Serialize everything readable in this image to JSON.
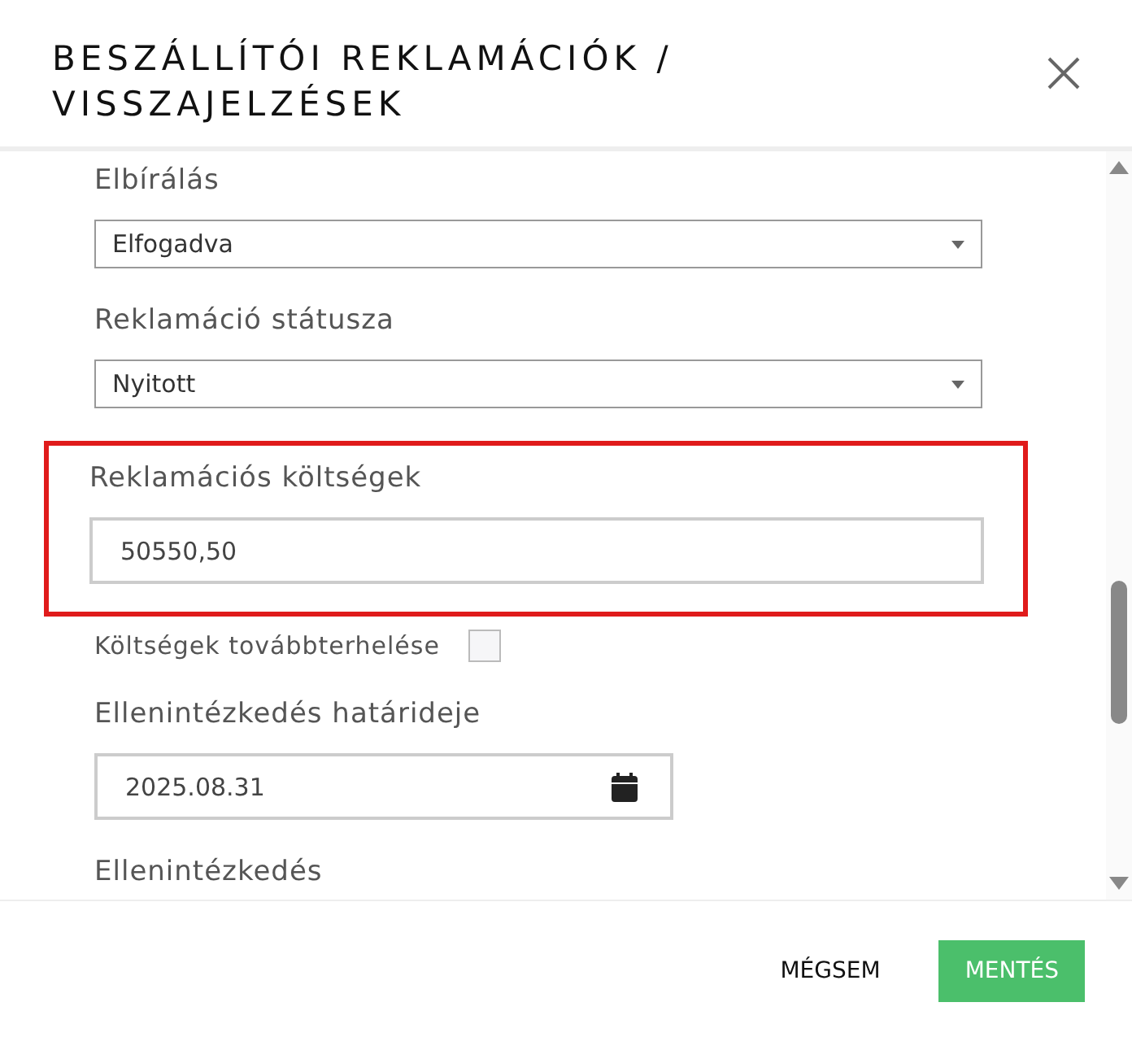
{
  "dialog": {
    "title": "BESZÁLLÍTÓI REKLAMÁCIÓK / VISSZAJELZÉSEK"
  },
  "fields": [
    {
      "kind": "select",
      "label": "Elbírálás",
      "value": "Elfogadva",
      "highlighted": false
    },
    {
      "kind": "select",
      "label": "Reklamáció státusza",
      "value": "Nyitott",
      "highlighted": false
    },
    {
      "kind": "text",
      "label": "Reklamációs költségek",
      "value": "50550,50",
      "highlighted": true
    },
    {
      "kind": "checkbox",
      "label": "Költségek továbbterhelése",
      "checked": false,
      "highlighted": false
    },
    {
      "kind": "date",
      "label": "Ellenintézkedés határideje",
      "value": "2025.08.31",
      "highlighted": false
    },
    {
      "kind": "label",
      "label": "Ellenintézkedés",
      "highlighted": false
    }
  ],
  "buttons": [
    {
      "label": "MÉGSEM",
      "kind": "flat"
    },
    {
      "label": "MENTÉS",
      "kind": "primary"
    }
  ]
}
